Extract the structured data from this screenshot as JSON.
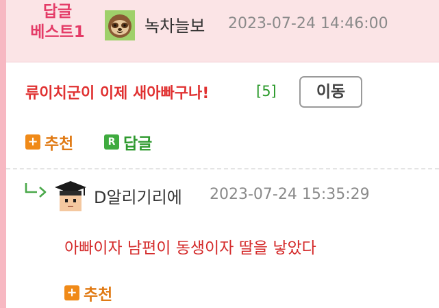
{
  "best_reply": {
    "badge_line1": "답글",
    "badge_line2": "베스트1",
    "username": "녹차늘보",
    "timestamp": "2023-07-24 14:46:00",
    "avatar": "sloth-avatar-icon"
  },
  "post": {
    "title": "류이치군이 이제 새아빠구나!",
    "comment_count": "[5]",
    "move_button": "이동",
    "recommend_label": "추천",
    "reply_label": "답글",
    "recommend_icon": "+",
    "reply_icon": "R"
  },
  "reply": {
    "username": "D알리기리에",
    "timestamp": "2023-07-24 15:35:29",
    "text": "아빠이자 남편이 동생이자 딸을 낳았다",
    "recommend_label": "추천",
    "recommend_icon": "+",
    "avatar": "graduate-avatar-icon"
  },
  "colors": {
    "accent_pink": "#e43b67",
    "title_red": "#e03131",
    "count_green": "#2a9a2a",
    "recommend_orange": "#f08a18",
    "reply_green": "#3fab3f"
  }
}
